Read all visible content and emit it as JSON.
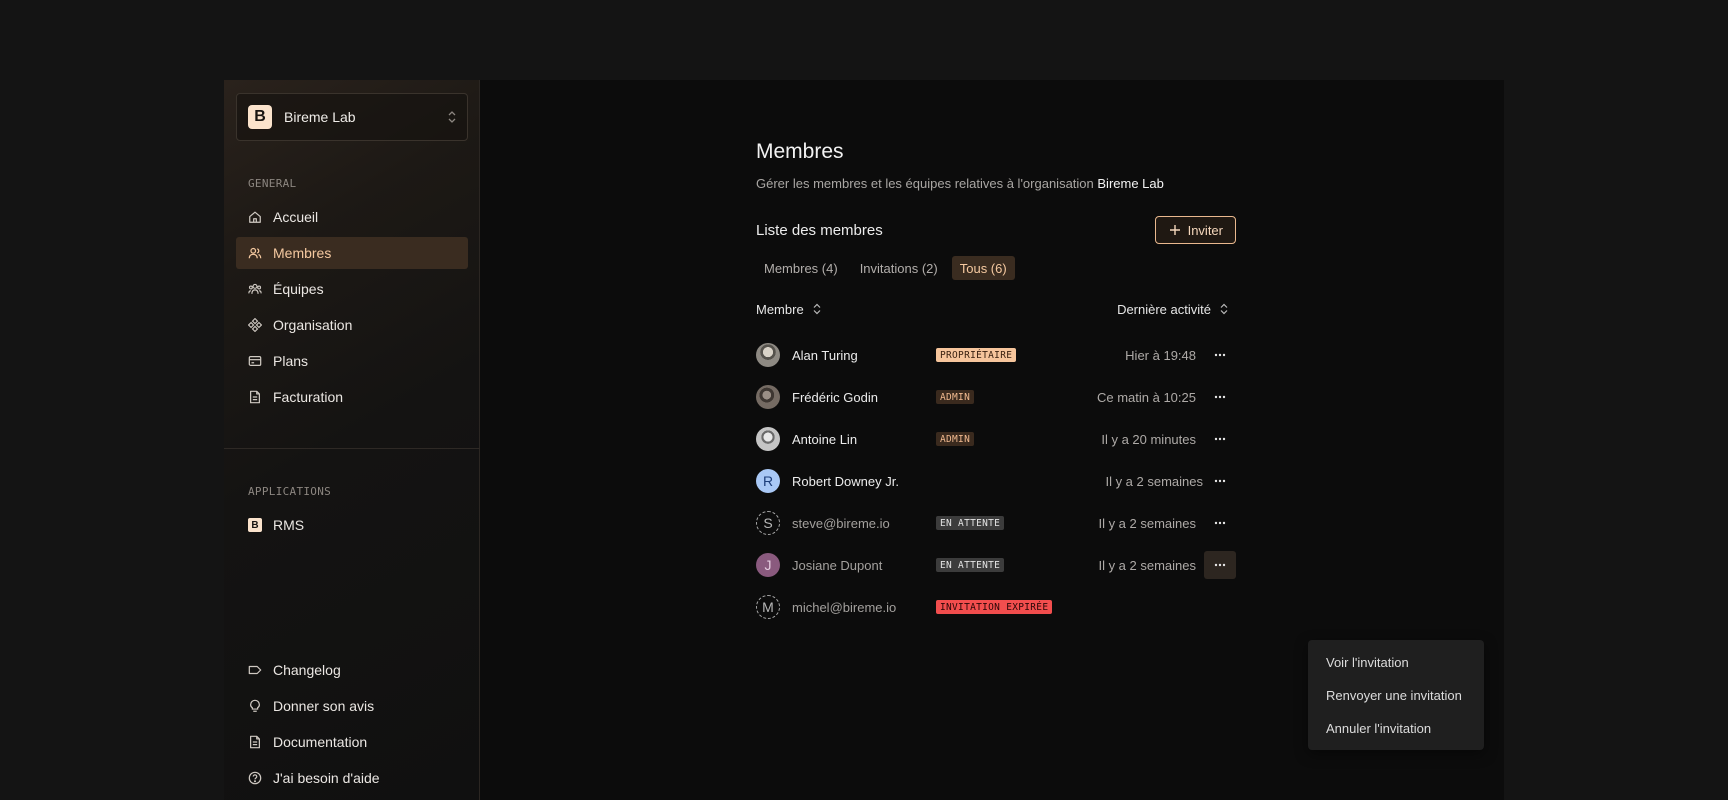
{
  "org": {
    "name": "Bireme Lab",
    "logo_letter": "B"
  },
  "sidebar": {
    "general_label": "GENERAL",
    "general_items": [
      {
        "label": "Accueil",
        "icon": "home-icon"
      },
      {
        "label": "Membres",
        "icon": "users-icon",
        "active": true
      },
      {
        "label": "Équipes",
        "icon": "teams-icon"
      },
      {
        "label": "Organisation",
        "icon": "organisation-icon"
      },
      {
        "label": "Plans",
        "icon": "credit-card-icon"
      },
      {
        "label": "Facturation",
        "icon": "invoice-icon"
      }
    ],
    "applications_label": "APPLICATIONS",
    "applications": [
      {
        "label": "RMS",
        "logo_letter": "B"
      }
    ],
    "footer_items": [
      {
        "label": "Changelog",
        "icon": "tag-icon"
      },
      {
        "label": "Donner son avis",
        "icon": "lightbulb-icon"
      },
      {
        "label": "Documentation",
        "icon": "document-icon"
      },
      {
        "label": "J'ai besoin d'aide",
        "icon": "help-icon"
      }
    ]
  },
  "page": {
    "title": "Membres",
    "subtitle": "Gérer les membres et les équipes relatives à l'organisation",
    "subtitle_org": "Bireme Lab",
    "list_title": "Liste des membres",
    "invite_label": "Inviter",
    "tabs": [
      {
        "label": "Membres (4)"
      },
      {
        "label": "Invitations (2)"
      },
      {
        "label": "Tous (6)",
        "active": true
      }
    ],
    "columns": {
      "member": "Membre",
      "last_activity": "Dernière activité"
    }
  },
  "members": [
    {
      "name": "Alan Turing",
      "avatar": "photo",
      "badge": "PROPRIÉTAIRE",
      "badge_type": "owner",
      "activity": "Hier à 19:48"
    },
    {
      "name": "Frédéric Godin",
      "avatar": "photo",
      "badge": "ADMIN",
      "badge_type": "admin",
      "activity": "Ce matin à 10:25"
    },
    {
      "name": "Antoine Lin",
      "avatar": "photo",
      "badge": "ADMIN",
      "badge_type": "admin",
      "activity": "Il y a 20 minutes"
    },
    {
      "name": "Robert Downey Jr.",
      "avatar": "R",
      "badge": "",
      "badge_type": "",
      "activity": "Il y a 2 semaines"
    },
    {
      "name": "steve@bireme.io",
      "avatar": "S",
      "badge": "EN ATTENTE",
      "badge_type": "pending",
      "activity": "Il y a 2 semaines"
    },
    {
      "name": "Josiane Dupont",
      "avatar": "J",
      "badge": "EN ATTENTE",
      "badge_type": "pending",
      "activity": "Il y a 2 semaines"
    },
    {
      "name": "michel@bireme.io",
      "avatar": "M",
      "badge": "INVITATION EXPIRÉE",
      "badge_type": "expired",
      "activity": ""
    }
  ],
  "dropdown": {
    "items": [
      {
        "label": "Voir l'invitation"
      },
      {
        "label": "Renvoyer une invitation"
      },
      {
        "label": "Annuler l'invitation"
      }
    ]
  },
  "colors": {
    "accent": "#f5c9a0",
    "active_bg": "#3a2c20",
    "expired": "#f24e4e"
  }
}
